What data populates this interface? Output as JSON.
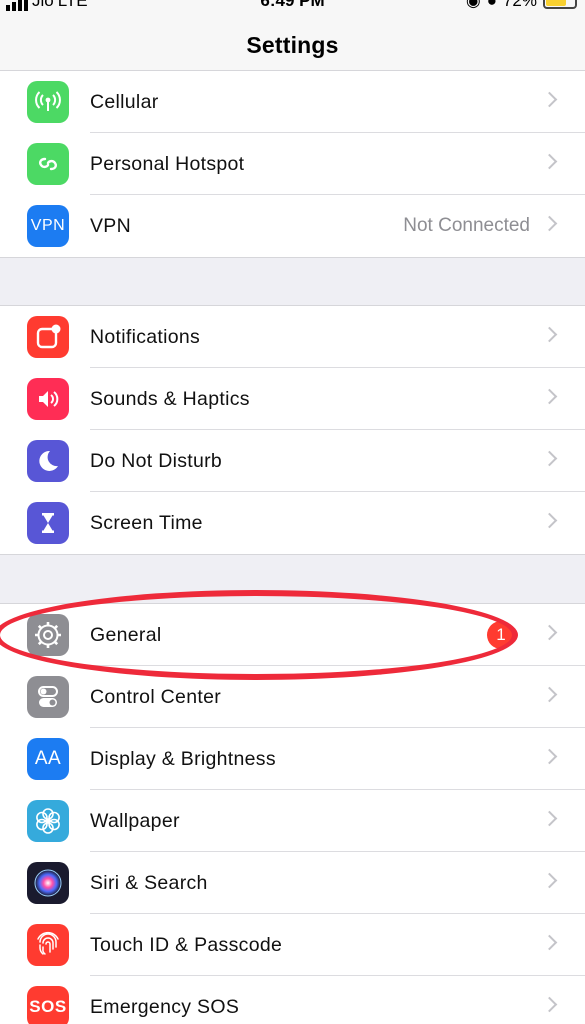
{
  "status_bar": {
    "carrier": "Jio",
    "network": "LTE",
    "time": "6:49 PM",
    "battery": "72%",
    "battery_level": 0.72
  },
  "nav": {
    "title": "Settings"
  },
  "groups": [
    {
      "rows": [
        {
          "label": "Cellular",
          "icon": "antenna-icon",
          "color": "#4cd964"
        },
        {
          "label": "Personal Hotspot",
          "icon": "hotspot-link-icon",
          "color": "#4cd964"
        },
        {
          "label": "VPN",
          "icon_text": "VPN",
          "value": "Not Connected",
          "color": "#1c7cf2"
        }
      ]
    },
    {
      "rows": [
        {
          "label": "Notifications",
          "icon": "notifications-icon",
          "color": "#ff3b30"
        },
        {
          "label": "Sounds & Haptics",
          "icon": "speaker-icon",
          "color": "#ff2d55"
        },
        {
          "label": "Do Not Disturb",
          "icon": "moon-icon",
          "color": "#5856d6"
        },
        {
          "label": "Screen Time",
          "icon": "hourglass-icon",
          "color": "#5856d6"
        }
      ]
    },
    {
      "rows": [
        {
          "label": "General",
          "icon": "gear-icon",
          "color": "#8e8e93",
          "badge": "1"
        },
        {
          "label": "Control Center",
          "icon": "toggles-icon",
          "color": "#8e8e93"
        },
        {
          "label": "Display & Brightness",
          "icon_text": "AA",
          "color": "#1c7cf2"
        },
        {
          "label": "Wallpaper",
          "icon": "flower-icon",
          "color": "#35aadc"
        },
        {
          "label": "Siri & Search",
          "icon": "siri-icon",
          "color": "#1a1a2e"
        },
        {
          "label": "Touch ID & Passcode",
          "icon": "fingerprint-icon",
          "color": "#ff3b30"
        },
        {
          "label": "Emergency SOS",
          "icon_text": "SOS",
          "color": "#ff3b30"
        }
      ]
    }
  ]
}
